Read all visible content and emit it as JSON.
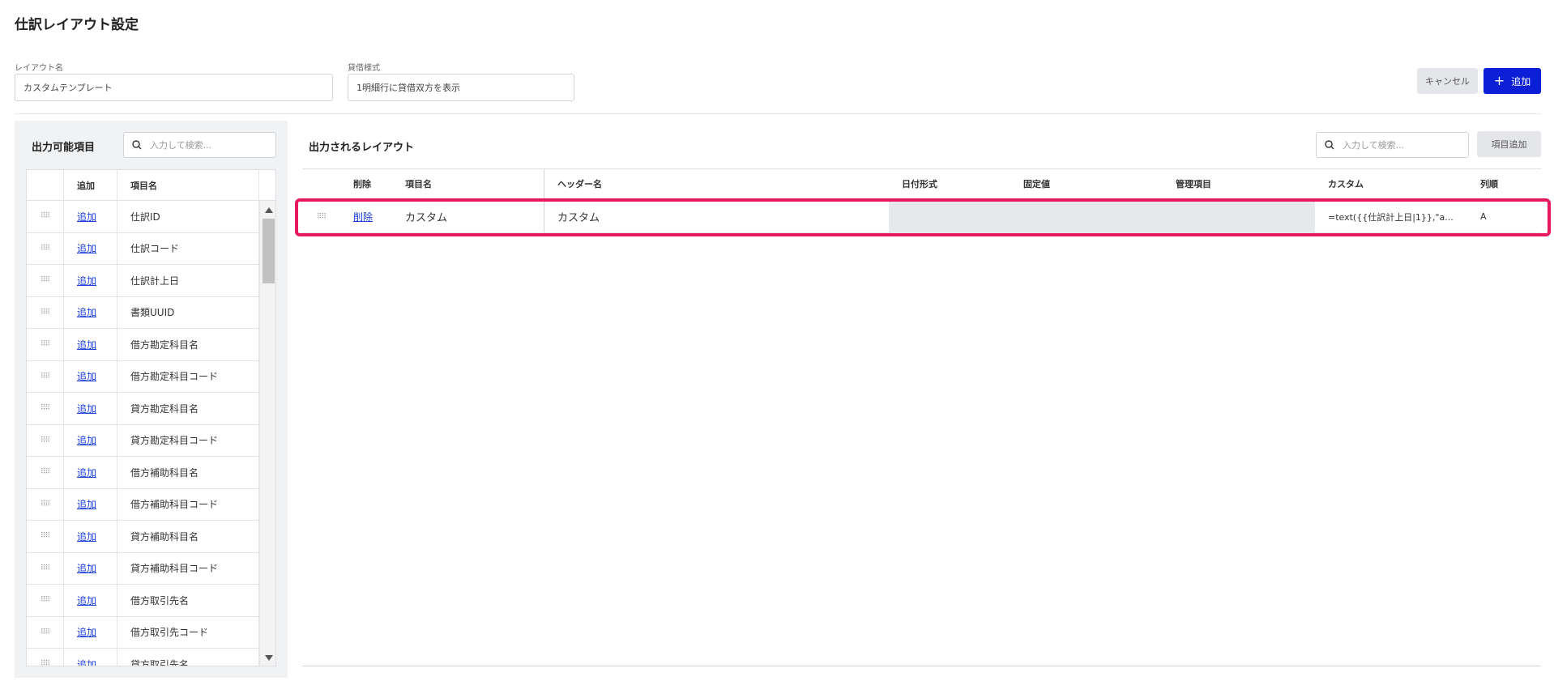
{
  "page": {
    "title": "仕訳レイアウト設定"
  },
  "form": {
    "layout_name_label": "レイアウト名",
    "layout_name_value": "カスタムテンプレート",
    "debit_credit_label": "貸借様式",
    "debit_credit_value": "1明細行に貸借双方を表示"
  },
  "actions": {
    "cancel_label": "キャンセル",
    "add_label": "追加"
  },
  "left_panel": {
    "title": "出力可能項目",
    "search_placeholder": "入力して検索...",
    "columns": {
      "add": "追加",
      "name": "項目名"
    },
    "add_link_label": "追加",
    "items": [
      "仕訳ID",
      "仕訳コード",
      "仕訳計上日",
      "書類UUID",
      "借方勘定科目名",
      "借方勘定科目コード",
      "貸方勘定科目名",
      "貸方勘定科目コード",
      "借方補助科目名",
      "借方補助科目コード",
      "貸方補助科目名",
      "貸方補助科目コード",
      "借方取引先名",
      "借方取引先コード",
      "貸方取引先名"
    ]
  },
  "right_panel": {
    "title": "出力されるレイアウト",
    "search_placeholder": "入力して検索...",
    "item_add_label": "項目追加",
    "columns": {
      "delete": "削除",
      "name": "項目名",
      "header": "ヘッダー名",
      "date_format": "日付形式",
      "fixed_value": "固定値",
      "management": "管理項目",
      "custom": "カスタム",
      "order": "列順"
    },
    "rows": [
      {
        "delete_label": "削除",
        "name": "カスタム",
        "header": "カスタム",
        "date_format": "",
        "fixed_value": "",
        "management": "",
        "custom": "=text({{仕訳計上日|1}},\"a...",
        "order": "A"
      }
    ]
  },
  "colors": {
    "accent": "#0a1fd6",
    "highlight": "#e8185f",
    "link": "#1a3de0"
  }
}
